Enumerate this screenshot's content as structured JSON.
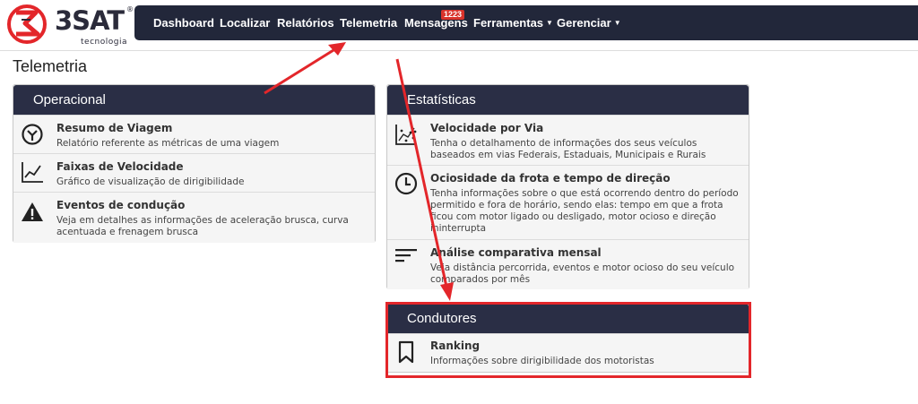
{
  "brand": {
    "name": "3SAT",
    "registered": "®",
    "tagline": "tecnologia",
    "accent": "#e3262a",
    "dark": "#2b2b3a"
  },
  "nav": {
    "items": [
      {
        "label": "Dashboard"
      },
      {
        "label": "Localizar"
      },
      {
        "label": "Relatórios"
      },
      {
        "label": "Telemetria"
      },
      {
        "label": "Mensagens"
      },
      {
        "label": "Ferramentas",
        "dropdown": true
      },
      {
        "label": "Gerenciar",
        "dropdown": true
      }
    ],
    "messages_badge": "1223",
    "background": "#22273a",
    "badge_color": "#d9332b"
  },
  "page": {
    "title": "Telemetria"
  },
  "panels": {
    "operacional": {
      "title": "Operacional",
      "items": [
        {
          "icon": "speed-gauge-icon",
          "title": "Resumo de Viagem",
          "desc": [
            "Relatório referente as métricas de uma viagem"
          ]
        },
        {
          "icon": "line-chart-icon",
          "title": "Faixas de Velocidade",
          "desc": [
            "Gráfico de visualização de dirigibilidade"
          ]
        },
        {
          "icon": "warning-icon",
          "title": "Eventos de condução",
          "desc": [
            "Veja em detalhes as informações de aceleração brusca, curva",
            "acentuada e frenagem brusca"
          ]
        }
      ]
    },
    "estatisticas": {
      "title": "Estatísticas",
      "items": [
        {
          "icon": "scatter-chart-icon",
          "title": "Velocidade por Via",
          "desc": [
            "Tenha o detalhamento de informações dos seus veículos",
            "baseados em vias Federais, Estaduais, Municipais e Rurais"
          ]
        },
        {
          "icon": "clock-icon",
          "title": "Ociosidade da frota e tempo de direção",
          "desc": [
            "Tenha informações sobre o que está ocorrendo dentro do período",
            "permitido e fora de horário, sendo elas: tempo em que a frota",
            "ficou com motor ligado ou desligado, motor ocioso e direção",
            "ininterrupta"
          ]
        },
        {
          "icon": "bars-icon",
          "title": "Análise comparativa mensal",
          "desc": [
            "Veja distância percorrida, eventos e motor ocioso do seu veículo",
            "comparados por mês"
          ]
        }
      ]
    },
    "condutores": {
      "title": "Condutores",
      "items": [
        {
          "icon": "bookmark-icon",
          "title": "Ranking",
          "desc": [
            "Informações sobre dirigibilidade dos motoristas"
          ]
        }
      ]
    }
  },
  "annotation_color": "#e3262a"
}
